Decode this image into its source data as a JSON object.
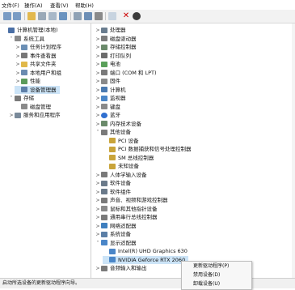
{
  "menu": [
    "文件(F)",
    "操作(A)",
    "查看(V)",
    "帮助(H)"
  ],
  "left_tree": [
    {
      "label": "计算机管理(本地)",
      "exp": "",
      "indent": 0,
      "icon": "computer-mgmt-icon",
      "color": "#4a6fa5"
    },
    {
      "label": "系统工具",
      "exp": "˅",
      "indent": 1,
      "icon": "system-tools-icon",
      "color": "#8a8a8a"
    },
    {
      "label": "任务计划程序",
      "exp": ">",
      "indent": 2,
      "icon": "task-scheduler-icon",
      "color": "#6b8fb5"
    },
    {
      "label": "事件查看器",
      "exp": ">",
      "indent": 2,
      "icon": "event-viewer-icon",
      "color": "#777777"
    },
    {
      "label": "共享文件夹",
      "exp": ">",
      "indent": 2,
      "icon": "shared-folder-icon",
      "color": "#e0b84a"
    },
    {
      "label": "本地用户和组",
      "exp": ">",
      "indent": 2,
      "icon": "users-groups-icon",
      "color": "#6a8bb0"
    },
    {
      "label": "性能",
      "exp": ">",
      "indent": 2,
      "icon": "performance-icon",
      "color": "#5b9b5b"
    },
    {
      "label": "设备管理器",
      "exp": "",
      "indent": 2,
      "icon": "device-manager-icon",
      "color": "#5d7fa8",
      "selected": true
    },
    {
      "label": "存储",
      "exp": "˅",
      "indent": 1,
      "icon": "storage-icon",
      "color": "#7a7a7a"
    },
    {
      "label": "磁盘管理",
      "exp": "",
      "indent": 2,
      "icon": "disk-management-icon",
      "color": "#8a8a8a"
    },
    {
      "label": "服务和应用程序",
      "exp": ">",
      "indent": 1,
      "icon": "services-apps-icon",
      "color": "#7a8a9a"
    }
  ],
  "right_tree": [
    {
      "label": "处理器",
      "exp": ">",
      "indent": 0,
      "icon": "processor-icon",
      "color": "#6a7d8f"
    },
    {
      "label": "磁盘驱动器",
      "exp": ">",
      "indent": 0,
      "icon": "disk-drive-icon",
      "color": "#7d7d7d"
    },
    {
      "label": "存储控制器",
      "exp": ">",
      "indent": 0,
      "icon": "storage-controller-icon",
      "color": "#6b8a6b"
    },
    {
      "label": "打印队列",
      "exp": ">",
      "indent": 0,
      "icon": "print-queue-icon",
      "color": "#6c6c6c"
    },
    {
      "label": "电池",
      "exp": ">",
      "indent": 0,
      "icon": "battery-icon",
      "color": "#5aa05a"
    },
    {
      "label": "端口 (COM 和 LPT)",
      "exp": ">",
      "indent": 0,
      "icon": "port-icon",
      "color": "#7a7a7a"
    },
    {
      "label": "固件",
      "exp": ">",
      "indent": 0,
      "icon": "firmware-icon",
      "color": "#8a8a8a"
    },
    {
      "label": "计算机",
      "exp": ">",
      "indent": 0,
      "icon": "computer-icon",
      "color": "#4a7ab0"
    },
    {
      "label": "监视器",
      "exp": ">",
      "indent": 0,
      "icon": "monitor-icon",
      "color": "#4a86c8"
    },
    {
      "label": "键盘",
      "exp": ">",
      "indent": 0,
      "icon": "keyboard-icon",
      "color": "#8a8a8a"
    },
    {
      "label": "蓝牙",
      "exp": ">",
      "indent": 0,
      "icon": "bluetooth-icon",
      "color": "#2f6fd0",
      "circle": true
    },
    {
      "label": "内存技术设备",
      "exp": ">",
      "indent": 0,
      "icon": "memory-device-icon",
      "color": "#6a8a6a"
    },
    {
      "label": "其他设备",
      "exp": "˅",
      "indent": 0,
      "icon": "other-devices-icon",
      "color": "#7a7a7a"
    },
    {
      "label": "PCI 设备",
      "exp": "",
      "indent": 1,
      "icon": "unknown-device-icon",
      "color": "#c9a43a"
    },
    {
      "label": "PCI 数据捕获和信号处理控制器",
      "exp": "",
      "indent": 1,
      "icon": "unknown-device-icon",
      "color": "#c9a43a"
    },
    {
      "label": "SM 总线控制器",
      "exp": "",
      "indent": 1,
      "icon": "unknown-device-icon",
      "color": "#c9a43a"
    },
    {
      "label": "未知设备",
      "exp": "",
      "indent": 1,
      "icon": "unknown-device-icon",
      "color": "#c9a43a"
    },
    {
      "label": "人体学输入设备",
      "exp": ">",
      "indent": 0,
      "icon": "hid-icon",
      "color": "#7a7a7a"
    },
    {
      "label": "软件设备",
      "exp": ">",
      "indent": 0,
      "icon": "software-device-icon",
      "color": "#6a7a8a"
    },
    {
      "label": "软件组件",
      "exp": ">",
      "indent": 0,
      "icon": "software-component-icon",
      "color": "#6a7a8a"
    },
    {
      "label": "声音、视频和游戏控制器",
      "exp": ">",
      "indent": 0,
      "icon": "sound-icon",
      "color": "#7a7a7a"
    },
    {
      "label": "鼠标和其他指针设备",
      "exp": ">",
      "indent": 0,
      "icon": "mouse-icon",
      "color": "#8a8a8a"
    },
    {
      "label": "通用串行总线控制器",
      "exp": ">",
      "indent": 0,
      "icon": "usb-icon",
      "color": "#7a7a7a"
    },
    {
      "label": "网络适配器",
      "exp": ">",
      "indent": 0,
      "icon": "network-adapter-icon",
      "color": "#3f7fbf"
    },
    {
      "label": "系统设备",
      "exp": ">",
      "indent": 0,
      "icon": "system-device-icon",
      "color": "#5b7fa6"
    },
    {
      "label": "显示适配器",
      "exp": "˅",
      "indent": 0,
      "icon": "display-adapter-icon",
      "color": "#4a86c8"
    },
    {
      "label": "Intel(R) UHD Graphics 630",
      "exp": "",
      "indent": 1,
      "icon": "display-adapter-icon",
      "color": "#4a86c8"
    },
    {
      "label": "NVIDIA Geforce RTX 2060",
      "exp": "",
      "indent": 1,
      "icon": "display-adapter-icon",
      "color": "#4a86c8",
      "selected": true
    },
    {
      "label": "音频输入和输出",
      "exp": ">",
      "indent": 0,
      "icon": "audio-io-icon",
      "color": "#7a7a7a"
    }
  ],
  "context_menu": [
    "更新驱动程序(P)",
    "禁用设备(D)",
    "卸载设备(U)"
  ],
  "status": "启动所选设备的更新驱动程序向导。"
}
